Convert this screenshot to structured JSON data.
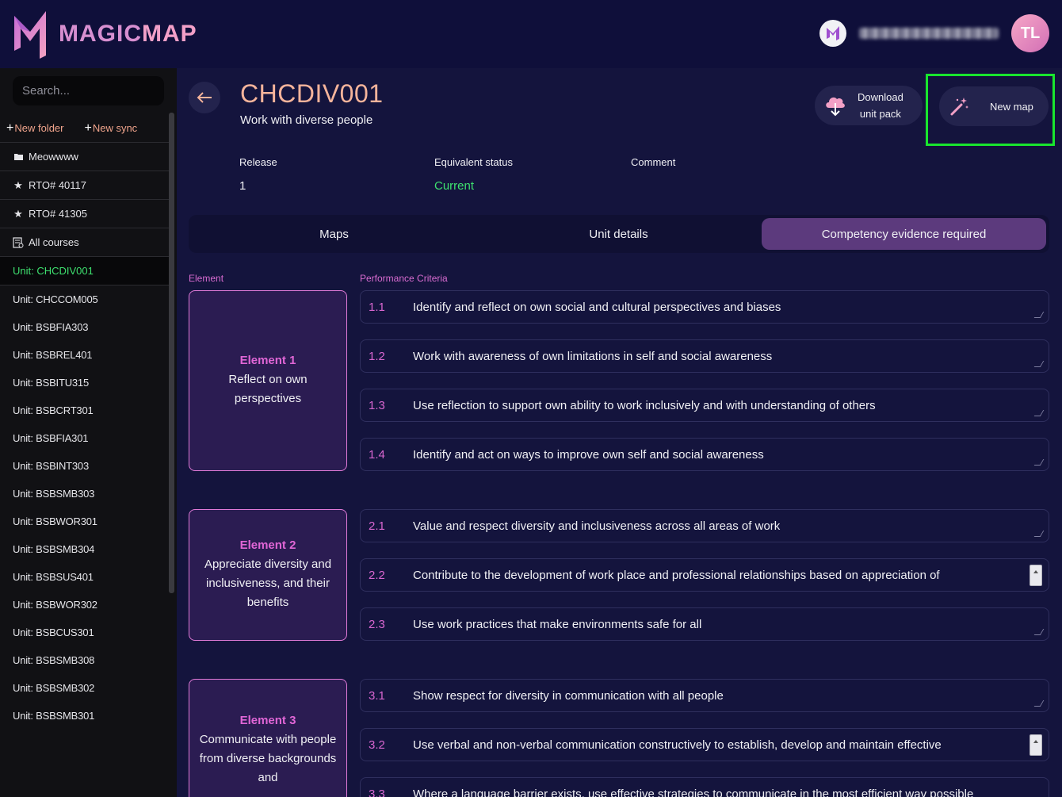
{
  "app": {
    "logo_text_a": "MAGIC",
    "logo_text_b": "MAP"
  },
  "user": {
    "initials": "TL"
  },
  "sidebar": {
    "search_placeholder": "Search...",
    "new_folder": "New folder",
    "new_sync": "New sync",
    "items": [
      {
        "label": "Meowwww",
        "icon": "folder-icon"
      },
      {
        "label": "RTO# 40117",
        "icon": "star-icon"
      },
      {
        "label": "RTO# 41305",
        "icon": "star-icon"
      },
      {
        "label": "All courses",
        "icon": "courses-icon"
      },
      {
        "label": "Unit: CHCDIV001",
        "icon": ""
      }
    ],
    "units": [
      "Unit: CHCCOM005",
      "Unit: BSBFIA303",
      "Unit: BSBREL401",
      "Unit: BSBITU315",
      "Unit: BSBCRT301",
      "Unit: BSBFIA301",
      "Unit: BSBINT303",
      "Unit: BSBSMB303",
      "Unit: BSBWOR301",
      "Unit: BSBSMB304",
      "Unit: BSBSUS401",
      "Unit: BSBWOR302",
      "Unit: BSBCUS301",
      "Unit: BSBSMB308",
      "Unit: BSBSMB302",
      "Unit: BSBSMB301"
    ]
  },
  "header": {
    "code": "CHCDIV001",
    "title": "Work with diverse people",
    "download_line1": "Download",
    "download_line2": "unit pack",
    "new_map": "New map"
  },
  "meta": {
    "release_label": "Release",
    "release_value": "1",
    "status_label": "Equivalent status",
    "status_value": "Current",
    "comment_label": "Comment",
    "comment_value": ""
  },
  "tabs": [
    "Maps",
    "Unit details",
    "Competency evidence required"
  ],
  "table": {
    "element_header": "Element",
    "criteria_header": "Performance Criteria",
    "elements": [
      {
        "num": "Element 1",
        "name": "Reflect on own perspectives"
      },
      {
        "num": "Element 2",
        "name": "Appreciate diversity and inclusiveness, and their benefits"
      },
      {
        "num": "Element 3",
        "name": "Communicate with people from diverse backgrounds and"
      }
    ],
    "criteria": [
      {
        "num": "1.1",
        "text": "Identify and reflect on own social and cultural perspectives and biases"
      },
      {
        "num": "1.2",
        "text": "Work with awareness of own limitations in self and social awareness"
      },
      {
        "num": "1.3",
        "text": "Use reflection to support own ability to work inclusively and with understanding of others"
      },
      {
        "num": "1.4",
        "text": "Identify and act on ways to improve own self and social awareness"
      },
      {
        "num": "2.1",
        "text": "Value and respect diversity and inclusiveness across all areas of work"
      },
      {
        "num": "2.2",
        "text": "Contribute to the development of work place and professional relationships based on appreciation of"
      },
      {
        "num": "2.3",
        "text": "Use work practices that make environments safe for all"
      },
      {
        "num": "3.1",
        "text": "Show respect for diversity in communication with all people"
      },
      {
        "num": "3.2",
        "text": "Use verbal and non-verbal communication constructively to establish, develop and maintain effective"
      },
      {
        "num": "3.3",
        "text": "Where a language barrier exists, use effective strategies to communicate in the most efficient way possible"
      }
    ]
  }
}
